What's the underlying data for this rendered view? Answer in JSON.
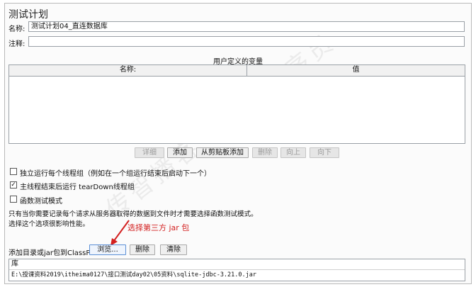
{
  "plan": {
    "title": "测试计划",
    "name_label": "名称:",
    "name_value": "测试计划04_直连数据库",
    "comment_label": "注释:",
    "comment_value": ""
  },
  "user_vars": {
    "title": "用户定义的变量",
    "columns": [
      "名称:",
      "值"
    ]
  },
  "buttons": {
    "detail": "详细",
    "add": "添加",
    "add_clipboard": "从剪贴板添加",
    "delete": "删除",
    "up": "向上",
    "down": "向下"
  },
  "options": {
    "run_groups": {
      "label": "独立运行每个线程组（例如在一个组运行结束后启动下一个）",
      "checked": ""
    },
    "teardown": {
      "label": "主线程结束后运行 tearDown线程组",
      "checked": "✓"
    },
    "functional": {
      "label": "函数测试模式",
      "checked": ""
    }
  },
  "note": {
    "line1": "只有当你需要记录每个请求从服务器取得的数据到文件时才需要选择函数测试模式。",
    "line2": "选择这个选项很影响性能。"
  },
  "annotation": {
    "text": "选择第三方 jar 包",
    "color": "#d32020"
  },
  "classpath": {
    "label": "添加目录或jar包到ClassPath",
    "browse": "浏览...",
    "delete": "删除",
    "clear": "清除",
    "lib_header": "库",
    "entries": [
      "E:\\授课资料2019\\itheima0127\\接口测试day02\\05资料\\sqlite-jdbc-3.21.0.jar"
    ]
  },
  "watermark": "传智播客一黑马程序员"
}
